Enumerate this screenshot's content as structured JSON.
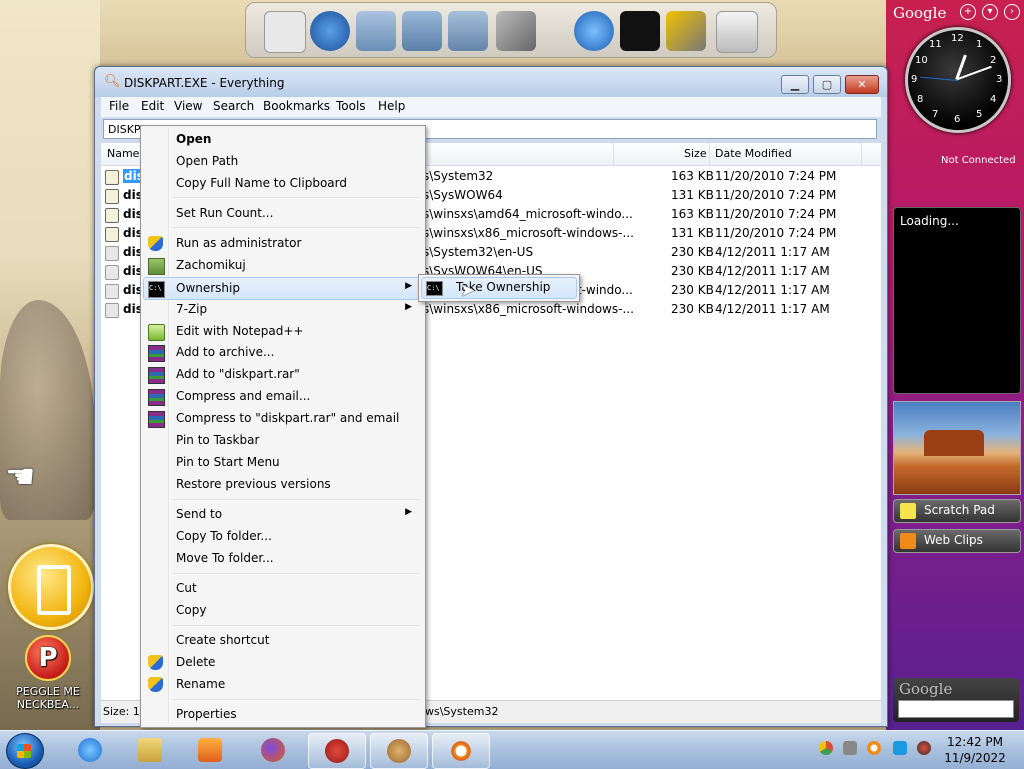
{
  "window": {
    "title": "DISKPART.EXE - Everything",
    "menu": [
      "File",
      "Edit",
      "View",
      "Search",
      "Bookmarks",
      "Tools",
      "Help"
    ],
    "search_value": "DISKPART.EXE",
    "columns": {
      "name": "Name",
      "size": "Size",
      "date": "Date Modified"
    },
    "rows": [
      {
        "name": "disk",
        "path": "s\\System32",
        "size": "163 KB",
        "date": "11/20/2010 7:24 PM"
      },
      {
        "name": "disk",
        "path": "s\\SysWOW64",
        "size": "131 KB",
        "date": "11/20/2010 7:24 PM"
      },
      {
        "name": "disk",
        "path": "s\\winsxs\\amd64_microsoft-windo...",
        "size": "163 KB",
        "date": "11/20/2010 7:24 PM"
      },
      {
        "name": "disk",
        "path": "s\\winsxs\\x86_microsoft-windows-...",
        "size": "131 KB",
        "date": "11/20/2010 7:24 PM"
      },
      {
        "name": "disk",
        "path": "s\\System32\\en-US",
        "size": "230 KB",
        "date": "4/12/2011 1:17 AM"
      },
      {
        "name": "disk",
        "path": "s\\SysWOW64\\en-US",
        "size": "230 KB",
        "date": "4/12/2011 1:17 AM"
      },
      {
        "name": "disk",
        "path": "s\\winsxs\\amd64_microsoft-windo...",
        "size": "230 KB",
        "date": "4/12/2011 1:17 AM"
      },
      {
        "name": "disk",
        "path": "s\\winsxs\\x86_microsoft-windows-...",
        "size": "230 KB",
        "date": "4/12/2011 1:17 AM"
      }
    ],
    "status_left": "Size: 16",
    "status_path": "ws\\System32"
  },
  "context_menu": {
    "items": [
      {
        "label": "Open"
      },
      {
        "label": "Open Path"
      },
      {
        "label": "Copy Full Name to Clipboard"
      },
      {
        "label": "Set Run Count..."
      },
      {
        "label": "Run as administrator",
        "icon": "uac-shield-icon"
      },
      {
        "label": "Zachomikuj",
        "icon": "chomikuj-icon"
      },
      {
        "label": "Ownership",
        "icon": "cmd-icon"
      },
      {
        "label": "7-Zip"
      },
      {
        "label": "Edit with Notepad++",
        "icon": "notepadpp-icon"
      },
      {
        "label": "Add to archive...",
        "icon": "winrar-icon"
      },
      {
        "label": "Add to \"diskpart.rar\"",
        "icon": "winrar-icon"
      },
      {
        "label": "Compress and email...",
        "icon": "winrar-icon"
      },
      {
        "label": "Compress to \"diskpart.rar\" and email",
        "icon": "winrar-icon"
      },
      {
        "label": "Pin to Taskbar"
      },
      {
        "label": "Pin to Start Menu"
      },
      {
        "label": "Restore previous versions"
      },
      {
        "label": "Send to"
      },
      {
        "label": "Copy To folder..."
      },
      {
        "label": "Move To folder..."
      },
      {
        "label": "Cut"
      },
      {
        "label": "Copy"
      },
      {
        "label": "Create shortcut"
      },
      {
        "label": "Delete",
        "icon": "uac-shield-icon"
      },
      {
        "label": "Rename",
        "icon": "uac-shield-icon"
      },
      {
        "label": "Properties"
      }
    ],
    "submenu_label": "Take Ownership"
  },
  "sidebar": {
    "google_label": "Google",
    "clock_numbers": [
      "12",
      "1",
      "2",
      "3",
      "4",
      "5",
      "6",
      "7",
      "8",
      "9",
      "10",
      "11"
    ],
    "not_connected": "Not Connected",
    "loading": "Loading...",
    "scratch_pad": "Scratch Pad",
    "web_clips": "Web Clips",
    "google_search_label": "Google"
  },
  "desktop": {
    "peggle_label": "PEGGLE ME NECKBEA..."
  },
  "taskbar": {
    "time": "12:42 PM",
    "date": "11/9/2022"
  }
}
